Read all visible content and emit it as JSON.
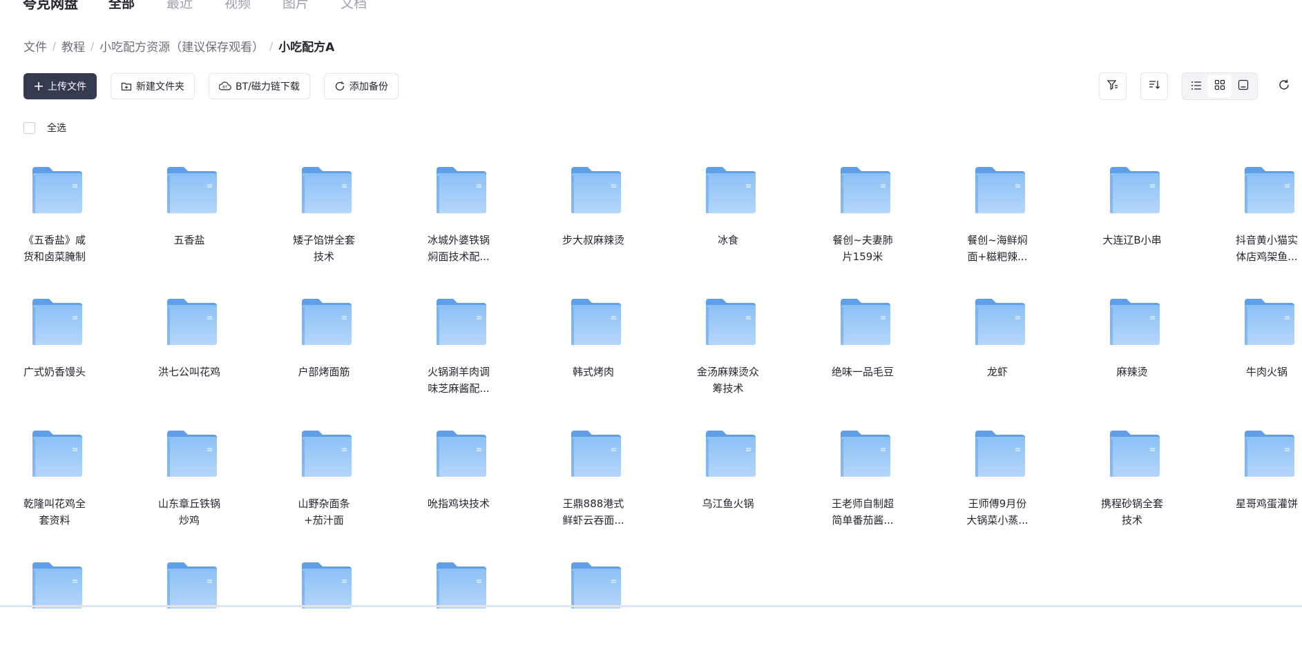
{
  "nav": {
    "brand": "夸克网盘",
    "tabs": [
      {
        "label": "全部",
        "active": true
      },
      {
        "label": "最近",
        "active": false
      },
      {
        "label": "视频",
        "active": false
      },
      {
        "label": "图片",
        "active": false
      },
      {
        "label": "文档",
        "active": false
      }
    ]
  },
  "breadcrumb": [
    "文件",
    "教程",
    "小吃配方资源（建议保存观看）",
    "小吃配方A"
  ],
  "toolbar": {
    "upload": "上传文件",
    "new_folder": "新建文件夹",
    "bt_download": "BT/磁力链下载",
    "add_backup": "添加备份"
  },
  "select_all": "全选",
  "colors": {
    "primary": "#363a4f",
    "folder": "#7fb6f2"
  },
  "folders": [
    [
      "《五香盐》咸",
      "货和卤菜腌制"
    ],
    [
      "五香盐"
    ],
    [
      "矮子馅饼全套",
      "技术"
    ],
    [
      "冰城外婆铁锅",
      "焖面技术配..."
    ],
    [
      "步大叔麻辣烫"
    ],
    [
      "冰食"
    ],
    [
      "餐创~夫妻肺",
      "片159米"
    ],
    [
      "餐创~海鲜焖",
      "面+糍粑辣..."
    ],
    [
      "大连辽B小串"
    ],
    [
      "抖音黄小猫实",
      "体店鸡架鱼..."
    ],
    [
      "广式奶香馒头"
    ],
    [
      "洪七公叫花鸡"
    ],
    [
      "户部烤面筋"
    ],
    [
      "火锅涮羊肉调",
      "味芝麻酱配..."
    ],
    [
      "韩式烤肉"
    ],
    [
      "金汤麻辣烫众",
      "筹技术"
    ],
    [
      "绝味一品毛豆"
    ],
    [
      "龙虾"
    ],
    [
      "麻辣烫"
    ],
    [
      "牛肉火锅"
    ],
    [
      "乾隆叫花鸡全",
      "套资料"
    ],
    [
      "山东章丘铁锅",
      "炒鸡"
    ],
    [
      "山野杂面条",
      "+茄汁面"
    ],
    [
      "吮指鸡块技术"
    ],
    [
      "王鼎888港式",
      "鲜虾云吞面..."
    ],
    [
      "乌江鱼火锅"
    ],
    [
      "王老师自制超",
      "简单番茄酱..."
    ],
    [
      "王师傅9月份",
      "大锅菜小蒸..."
    ],
    [
      "携程砂锅全套",
      "技术"
    ],
    [
      "星哥鸡蛋灌饼"
    ],
    [
      ""
    ],
    [
      ""
    ],
    [
      ""
    ],
    [
      ""
    ],
    [
      ""
    ]
  ]
}
